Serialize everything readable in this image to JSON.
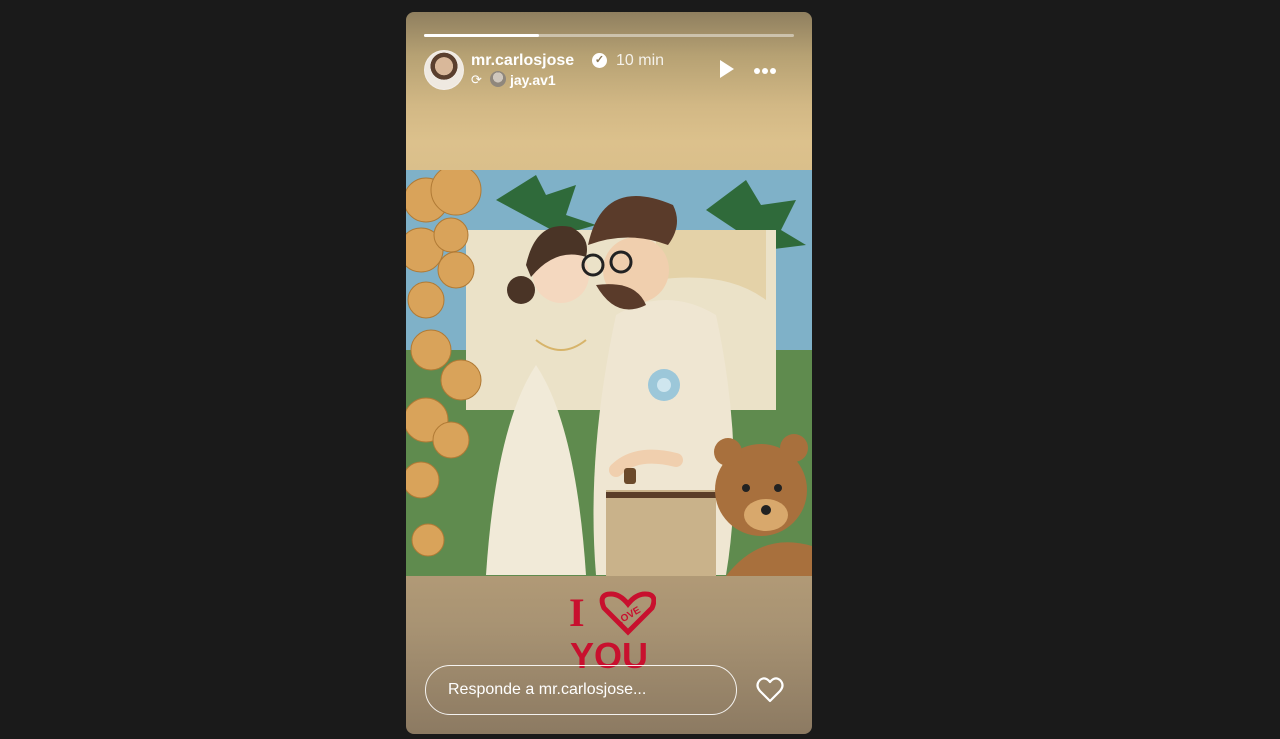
{
  "story": {
    "progress": 0.31,
    "username": "mr.carlosjose",
    "verified_glyph": "✓",
    "time": "10 min",
    "reposted_from": "jay.av1",
    "sticker_text": {
      "top": "I",
      "heart_word": "LOVE",
      "bottom": "YOU"
    },
    "reply_placeholder": "Responde a mr.carlosjose..."
  },
  "icons": {
    "repost": "repost-icon",
    "play": "play-icon",
    "more": "more-icon",
    "heart": "heart-icon"
  },
  "colors": {
    "page_bg": "#1a1a1a",
    "sticker_red": "#c8102e"
  }
}
